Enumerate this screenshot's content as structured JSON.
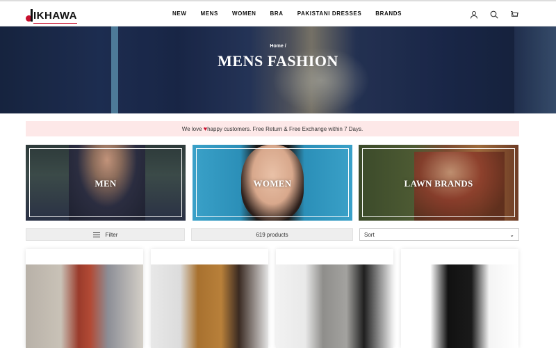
{
  "brand": {
    "logo_text": "IKHAWA",
    "colors": {
      "accent": "#c8102e",
      "announce_bg": "#fde8e8"
    }
  },
  "nav": {
    "items": [
      {
        "label": "NEW"
      },
      {
        "label": "MENS"
      },
      {
        "label": "WOMEN"
      },
      {
        "label": "BRA"
      },
      {
        "label": "PAKISTANI DRESSES"
      },
      {
        "label": "BRANDS"
      }
    ],
    "icons": [
      "user-icon",
      "search-icon",
      "cart-icon"
    ]
  },
  "hero": {
    "breadcrumb": "Home /",
    "title": "MENS FASHION"
  },
  "announcement": {
    "before": "We love ",
    "after": "happy customers. Free Return & Free Exchange within 7 Days."
  },
  "categories": [
    {
      "label": "MEN"
    },
    {
      "label": "WOMEN"
    },
    {
      "label": "LAWN BRANDS"
    }
  ],
  "toolbar": {
    "filter_label": "Filter",
    "product_count": "619 products",
    "sort_label": "Sort"
  },
  "products": [
    {
      "image": "man-in-red-plaid-shirt"
    },
    {
      "image": "man-in-brown-chinos"
    },
    {
      "image": "man-in-grey-trousers"
    },
    {
      "image": "man-in-black-formal-trousers"
    }
  ]
}
